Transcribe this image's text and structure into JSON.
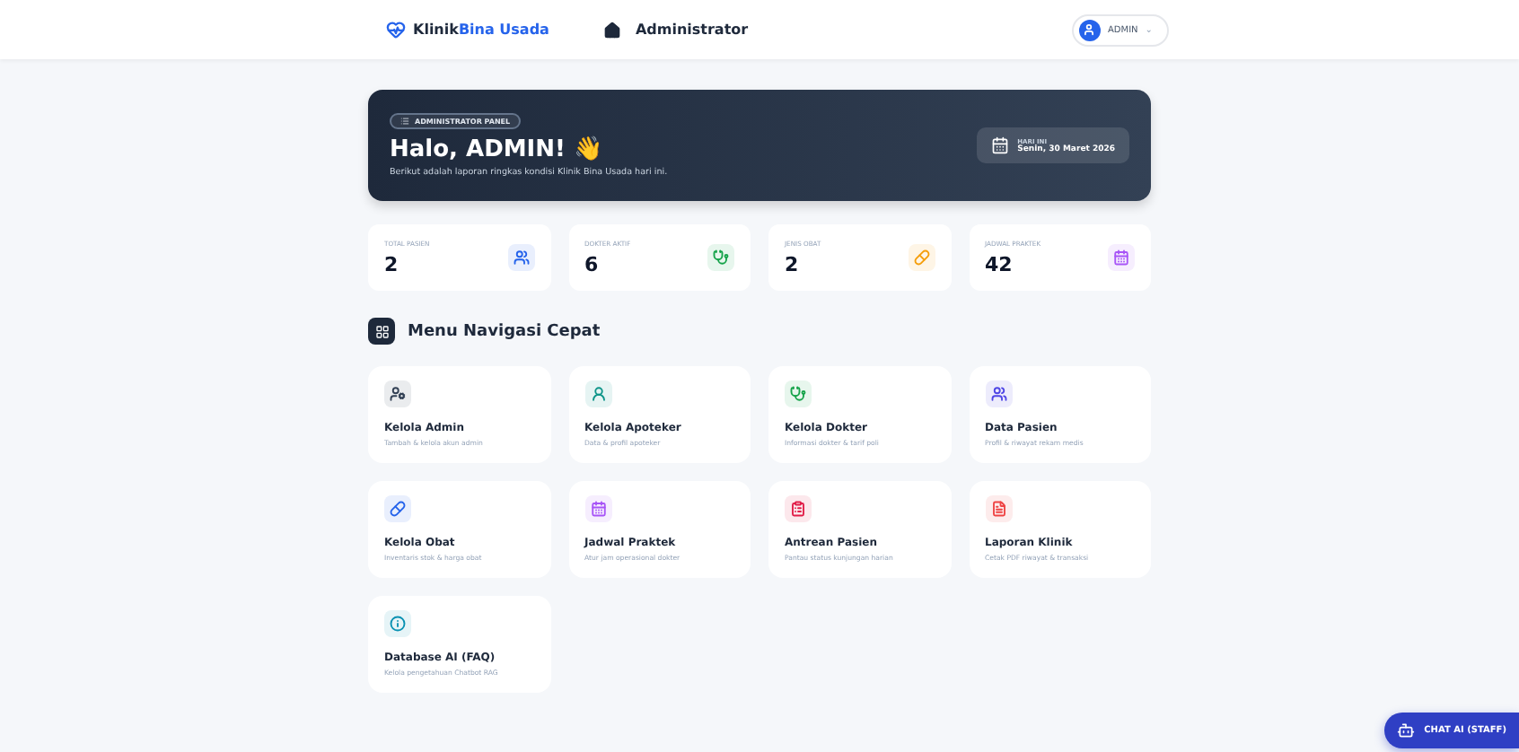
{
  "header": {
    "brand_first": "Klinik",
    "brand_second": "Bina Usada",
    "section": "Administrator",
    "user": "ADMIN",
    "user_caret": "⌄"
  },
  "hero": {
    "badge": "ADMINISTRATOR PANEL",
    "greeting": "Halo, ADMIN!",
    "wave": "👋",
    "subtitle": "Berikut adalah laporan ringkas kondisi Klinik Bina Usada hari ini.",
    "date_label": "HARI INI",
    "date": "Senin, 30 Maret 2026"
  },
  "stats": [
    {
      "label": "TOTAL PASIEN",
      "value": "2",
      "kind": "patients",
      "color": "#2563eb"
    },
    {
      "label": "DOKTER AKTIF",
      "value": "6",
      "kind": "doctor",
      "color": "#16a34a"
    },
    {
      "label": "JENIS OBAT",
      "value": "2",
      "kind": "pills",
      "color": "#f59e0b"
    },
    {
      "label": "JADWAL PRAKTEK",
      "value": "42",
      "kind": "calendar",
      "color": "#a855f7"
    }
  ],
  "menu_title": "Menu Navigasi Cepat",
  "menu": [
    {
      "title": "Kelola Admin",
      "desc": "Tambah & kelola akun admin",
      "kind": "admin",
      "color": "#334155"
    },
    {
      "title": "Kelola Apoteker",
      "desc": "Data & profil apoteker",
      "kind": "pharmacist",
      "color": "#0d9488"
    },
    {
      "title": "Kelola Dokter",
      "desc": "Informasi dokter & tarif poli",
      "kind": "doctor",
      "color": "#16a34a"
    },
    {
      "title": "Data Pasien",
      "desc": "Profil & riwayat rekam medis",
      "kind": "patients",
      "color": "#4f46e5"
    },
    {
      "title": "Kelola Obat",
      "desc": "Inventaris stok & harga obat",
      "kind": "pills",
      "color": "#2563eb"
    },
    {
      "title": "Jadwal Praktek",
      "desc": "Atur jam operasional dokter",
      "kind": "calendar",
      "color": "#a855f7"
    },
    {
      "title": "Antrean Pasien",
      "desc": "Pantau status kunjungan harian",
      "kind": "clipboard",
      "color": "#e11d48"
    },
    {
      "title": "Laporan Klinik",
      "desc": "Cetak PDF riwayat & transaksi",
      "kind": "file",
      "color": "#ef4444"
    },
    {
      "title": "Database AI (FAQ)",
      "desc": "Kelola pengetahuan Chatbot RAG",
      "kind": "info",
      "color": "#0891b2"
    }
  ],
  "chat_button": "CHAT AI (STAFF)"
}
